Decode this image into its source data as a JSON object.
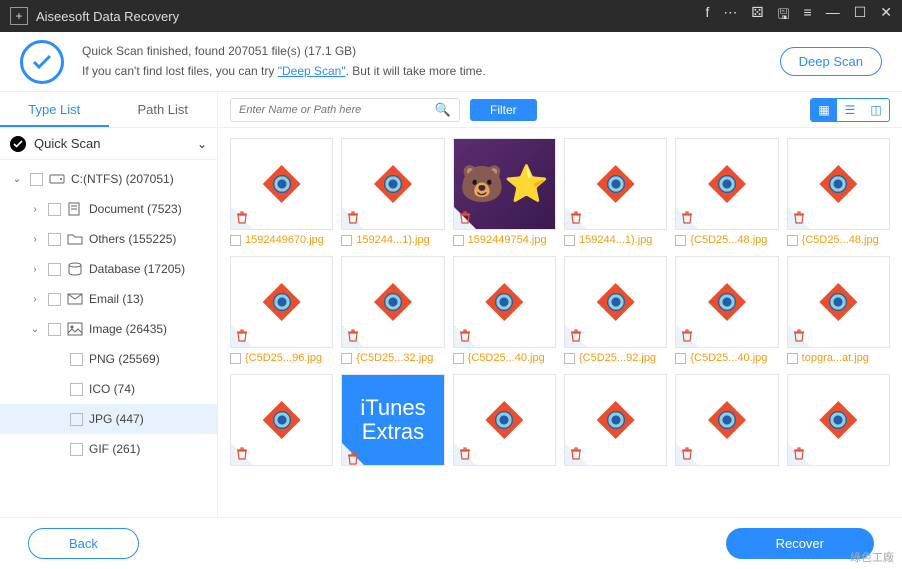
{
  "app": {
    "title": "Aiseesoft Data Recovery"
  },
  "info": {
    "line1_pre": "Quick Scan finished, found ",
    "file_count": "207051",
    "line1_mid": " file(s) (",
    "size": "17.1 GB",
    "line1_post": ")",
    "line2_pre": "If you can't find lost files, you can try ",
    "deepscan_link": "\"Deep Scan\"",
    "line2_post": ". But it will take more time.",
    "deepscan_btn": "Deep Scan"
  },
  "tabs": {
    "type": "Type List",
    "path": "Path List"
  },
  "qs_label": "Quick Scan",
  "tree": {
    "drive": "C:(NTFS) (207051)",
    "document": "Document (7523)",
    "others": "Others (155225)",
    "database": "Database (17205)",
    "email": "Email (13)",
    "image": "Image (26435)",
    "png": "PNG (25569)",
    "ico": "ICO (74)",
    "jpg": "JPG (447)",
    "gif": "GIF (261)"
  },
  "toolbar": {
    "search_placeholder": "Enter Name or Path here",
    "filter": "Filter"
  },
  "files": [
    {
      "name": "1592449670.jpg",
      "type": "eye"
    },
    {
      "name": "159244...1).jpg",
      "type": "eye"
    },
    {
      "name": "1592449754.jpg",
      "type": "bear"
    },
    {
      "name": "159244...1).jpg",
      "type": "eye"
    },
    {
      "name": "{C5D25...48.jpg",
      "type": "eye"
    },
    {
      "name": "{C5D25...48.jpg",
      "type": "eye"
    },
    {
      "name": "{C5D25...96.jpg",
      "type": "eye"
    },
    {
      "name": "{C5D25...32.jpg",
      "type": "eye"
    },
    {
      "name": "{C5D25...40.jpg",
      "type": "eye"
    },
    {
      "name": "{C5D25...92.jpg",
      "type": "eye"
    },
    {
      "name": "{C5D25...40.jpg",
      "type": "eye"
    },
    {
      "name": "topgra...at.jpg",
      "type": "eye"
    },
    {
      "name": "",
      "type": "eye"
    },
    {
      "name": "",
      "type": "itunes"
    },
    {
      "name": "",
      "type": "eye"
    },
    {
      "name": "",
      "type": "eye"
    },
    {
      "name": "",
      "type": "eye"
    },
    {
      "name": "",
      "type": "eye"
    }
  ],
  "itunes_text": "iTunes\nExtras",
  "footer": {
    "back": "Back",
    "recover": "Recover"
  },
  "watermark": "綠色工廠"
}
